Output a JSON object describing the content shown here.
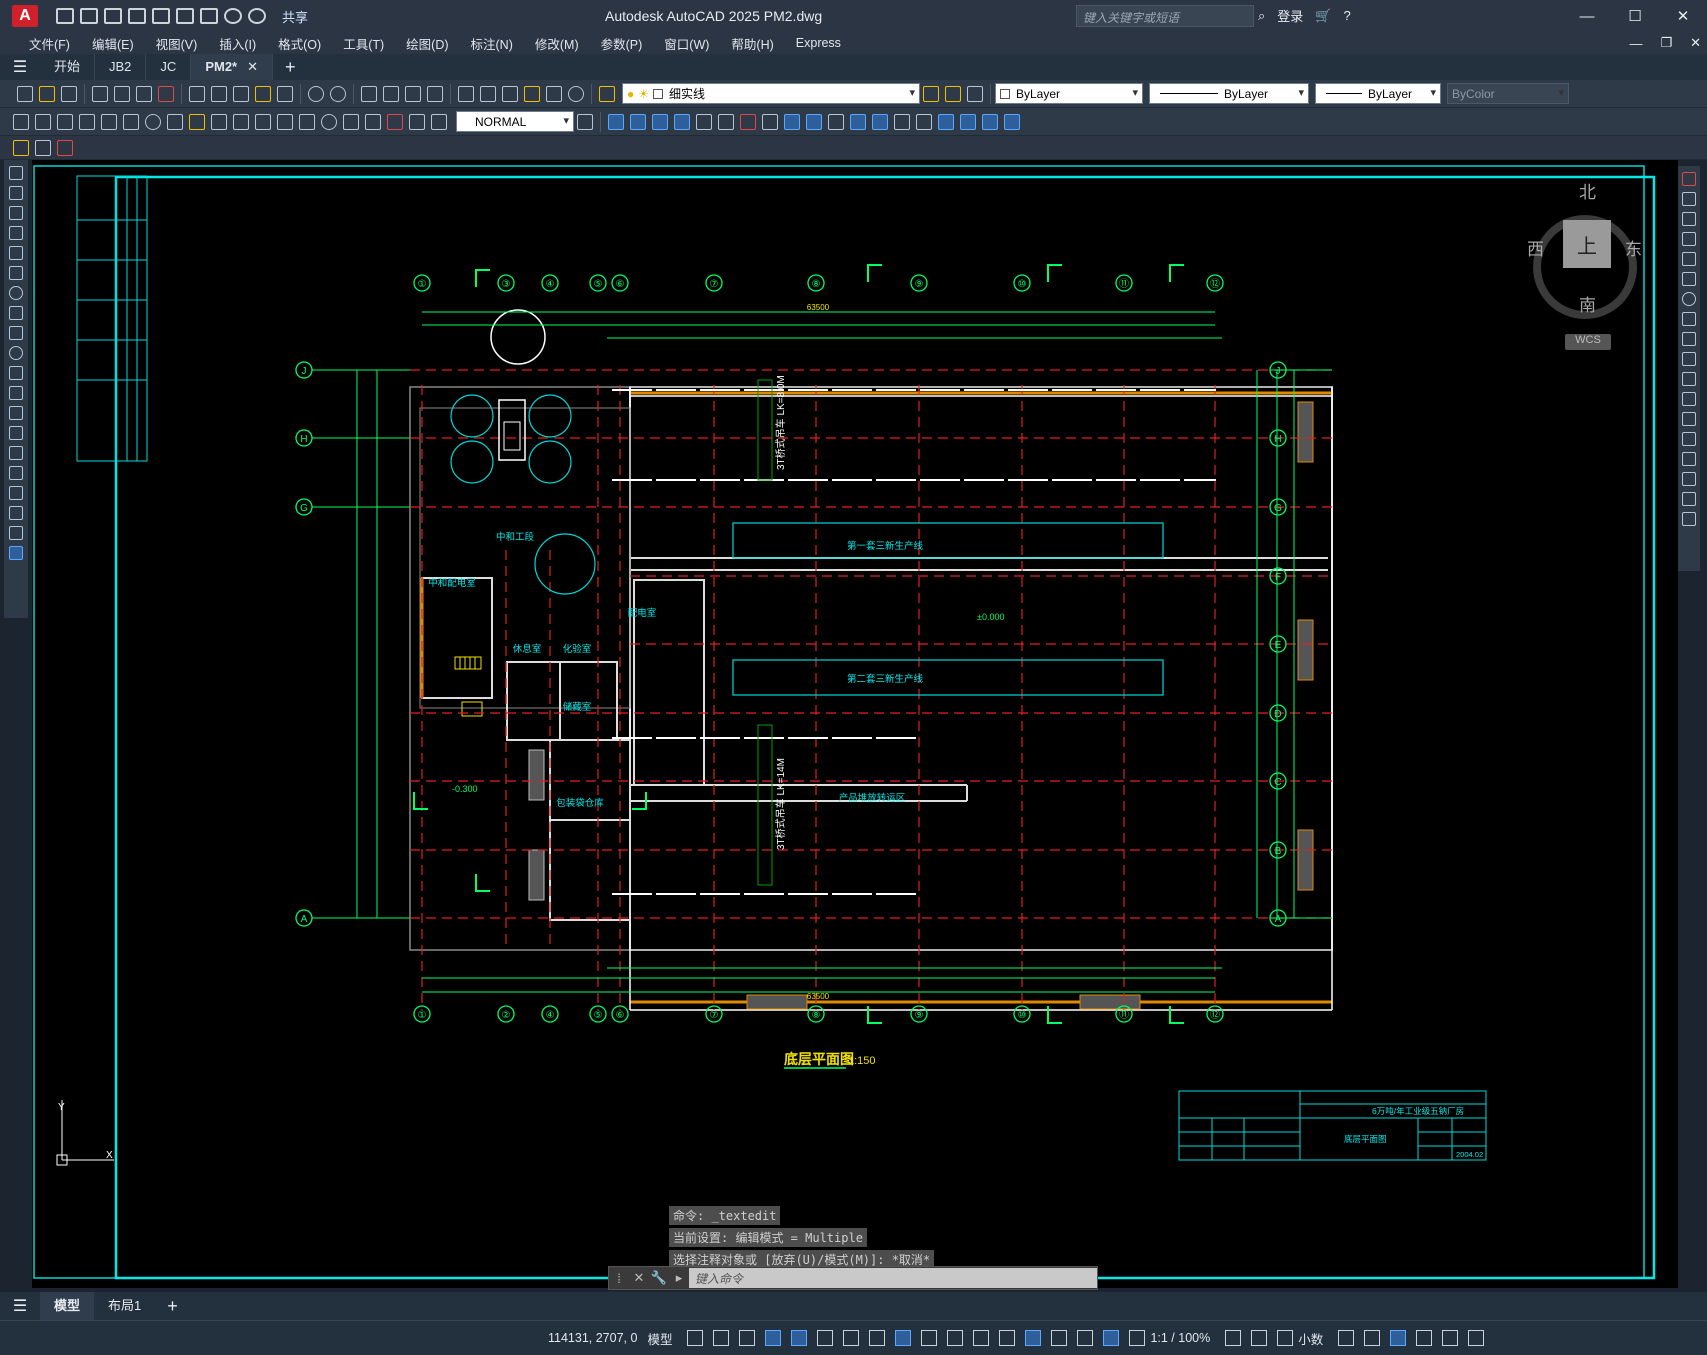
{
  "app": {
    "logo_letter": "A",
    "title": "Autodesk AutoCAD 2025    PM2.dwg",
    "share": "共享",
    "search_placeholder": "键入关键字或短语",
    "login": "登录",
    "help": "?"
  },
  "menu": [
    "文件(F)",
    "编辑(E)",
    "视图(V)",
    "插入(I)",
    "格式(O)",
    "工具(T)",
    "绘图(D)",
    "标注(N)",
    "修改(M)",
    "参数(P)",
    "窗口(W)",
    "帮助(H)",
    "Express"
  ],
  "tabs": [
    {
      "label": "开始",
      "active": false
    },
    {
      "label": "JB2",
      "active": false
    },
    {
      "label": "JC",
      "active": false
    },
    {
      "label": "PM2*",
      "active": true
    }
  ],
  "toolbar": {
    "layer_name": "细实线",
    "color": "ByLayer",
    "linetype": "ByLayer",
    "lineweight": "ByLayer",
    "plotstyle": "ByColor",
    "dimstyle": "NORMAL"
  },
  "viewcube": {
    "north": "北",
    "south": "南",
    "east": "东",
    "west": "西",
    "face": "上",
    "wcs": "WCS"
  },
  "drawing": {
    "title": "底层平面图",
    "scale": "1:150",
    "axes_top": [
      "①",
      "②",
      "③",
      "④",
      "⑤",
      "⑥",
      "⑦",
      "⑧",
      "⑨",
      "⑩",
      "⑪",
      "⑫"
    ],
    "axes_right": [
      "J",
      "H",
      "G",
      "F",
      "E",
      "D",
      "C",
      "B",
      "A"
    ],
    "total_dim": "63500",
    "rooms": [
      "第一套三新生产线",
      "第二套三新生产线",
      "产品堆放转运区",
      "配电室",
      "中和配电室",
      "休息室",
      "化验室",
      "储藏室",
      "包装袋仓库",
      "中和工段",
      "3T桥式吊车 LK=8.0M",
      "3T桥式吊车 LK=14M"
    ],
    "elev_1": "±0.000",
    "elev_2": "-0.300",
    "title_block": {
      "project": "6万吨/年工业级五钠厂房",
      "sheet": "底层平面图",
      "date": "2004.02"
    }
  },
  "command": {
    "history": [
      "命令: _textedit",
      "当前设置: 编辑模式 = Multiple",
      "选择注释对象或 [放弃(U)/模式(M)]: *取消*"
    ],
    "placeholder": "键入命令"
  },
  "layouts": [
    {
      "label": "模型",
      "active": true
    },
    {
      "label": "布局1",
      "active": false
    }
  ],
  "status": {
    "coords": "114131, 2707, 0",
    "space": "模型",
    "scale": "1:1 / 100%",
    "units": "小数"
  }
}
